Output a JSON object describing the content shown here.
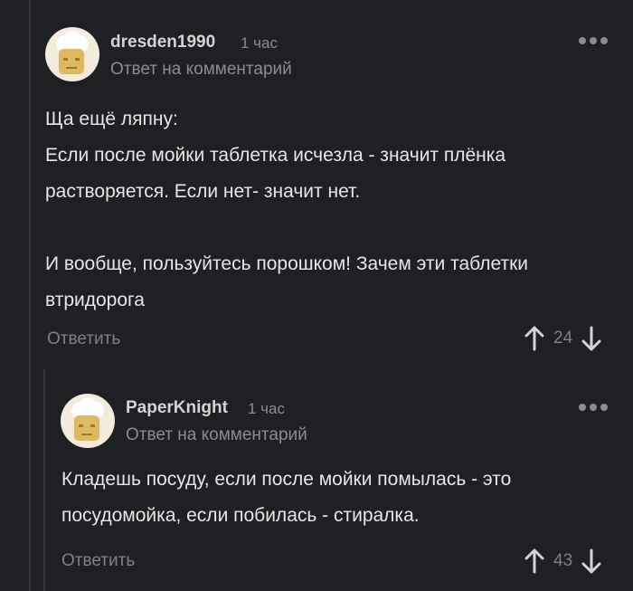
{
  "comments": [
    {
      "username": "dresden1990",
      "time": "1 час",
      "reply_label": "Ответ на комментарий",
      "body": "Ща ещё ляпну:\nЕсли после мойки таблетка исчезла - значит плёнка растворяется. Если нет- значит нет.\n\nИ вообще, пользуйтесь порошком! Зачем эти таблетки втридорога",
      "answer_label": "Ответить",
      "rating": "24"
    },
    {
      "username": "PaperKnight",
      "time": "1 час",
      "reply_label": "Ответ на комментарий",
      "body": "Кладешь посуду, если после мойки помылась - это посудомойка, если побилась - стиралка.",
      "answer_label": "Ответить",
      "rating": "43"
    }
  ],
  "icons": {
    "more": "more-dots-icon",
    "upvote": "arrow-up-icon",
    "downvote": "arrow-down-icon"
  },
  "colors": {
    "background": "#1f2023",
    "text": "#e6e6e6",
    "muted": "#8a8c90"
  }
}
